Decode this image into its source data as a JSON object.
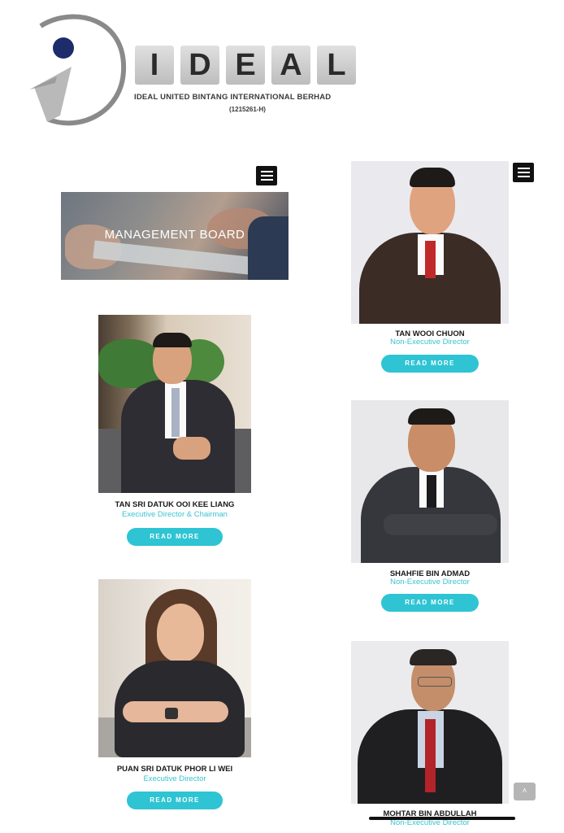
{
  "header": {
    "logo_letters": [
      "I",
      "D",
      "E",
      "A",
      "L"
    ],
    "company_name": "IDEAL UNITED BINTANG INTERNATIONAL BERHAD",
    "registration": "(1215261-H)"
  },
  "nav": {
    "menu_icon": "hamburger-icon"
  },
  "banner": {
    "title": "MANAGEMENT BOARD"
  },
  "directors": [
    {
      "name": "TAN SRI DATUK OOI KEE LIANG",
      "role": "Executive Director & Chairman",
      "button": "READ MORE"
    },
    {
      "name": "PUAN SRI DATUK PHOR LI WEI",
      "role": "Executive Director",
      "button": "READ MORE"
    },
    {
      "name": "TAN WOOI CHUON",
      "role": "Non-Executive Director",
      "button": "READ MORE"
    },
    {
      "name": "SHAHFIE BIN ADMAD",
      "role": "Non-Executive Director",
      "button": "READ MORE"
    },
    {
      "name": "MOHTAR BIN ABDULLAH",
      "role": "Non-Executive Director"
    }
  ],
  "scroll_top": {
    "icon": "chevron-up-icon",
    "glyph": "˄"
  },
  "colors": {
    "accent": "#2ec4d3",
    "role_text": "#39c3d1",
    "menu_bg": "#111111"
  }
}
